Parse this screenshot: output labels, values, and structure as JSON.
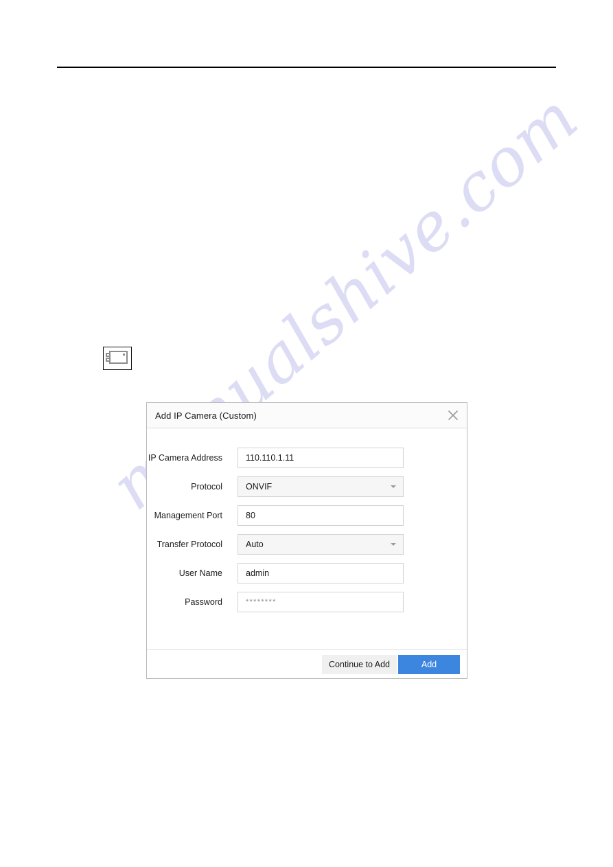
{
  "page": {
    "watermark_text": "manualshive.com"
  },
  "camera_glyph": {
    "icon": "camera-icon"
  },
  "dialog": {
    "title": "Add IP Camera (Custom)",
    "close_icon": "close-icon",
    "fields": [
      {
        "label": "IP Camera Address",
        "value": "110.110.1.11",
        "type": "text",
        "name": "ip-camera-address"
      },
      {
        "label": "Protocol",
        "value": "ONVIF",
        "type": "select",
        "name": "protocol"
      },
      {
        "label": "Management Port",
        "value": "80",
        "type": "text",
        "name": "management-port"
      },
      {
        "label": "Transfer Protocol",
        "value": "Auto",
        "type": "select",
        "name": "transfer-protocol"
      },
      {
        "label": "User Name",
        "value": "admin",
        "type": "text",
        "name": "user-name"
      },
      {
        "label": "Password",
        "value": "********",
        "type": "password",
        "name": "password"
      }
    ],
    "footer": {
      "continue_label": "Continue to Add",
      "add_label": "Add"
    },
    "colors": {
      "primary_button": "#3d86e0",
      "secondary_button": "#f0f0f0",
      "header_bg": "#fbfbfb",
      "border": "#b9b9b9"
    }
  }
}
